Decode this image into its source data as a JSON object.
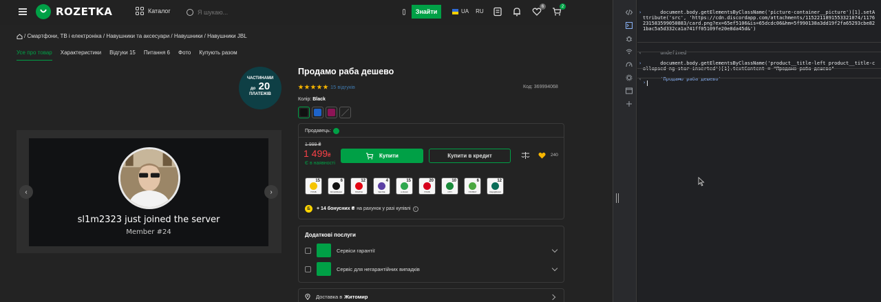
{
  "header": {
    "logo_text": "ROZETKA",
    "catalog_label": "Каталог",
    "search_placeholder": "Я шукаю...",
    "search_button": "Знайти",
    "lang_active": "UA",
    "lang_other": "RU",
    "wishlist_count": "6",
    "cart_count": "2",
    "brand_color": "#00a046"
  },
  "breadcrumb": "/ Смартфони, ТВ і електроніка / Навушники та аксесуари / Навушники / Навушники JBL",
  "tabs": [
    "Усе про товар",
    "Характеристики",
    "Відгуки 15",
    "Питання 6",
    "Фото",
    "Купують разом"
  ],
  "installments": {
    "line1": "ЧАСТИНАМИ",
    "prefix": "до",
    "number": "20",
    "line3": "ПЛАТЕЖІВ"
  },
  "gallery": {
    "join_text": "sl1m2323 just joined the server",
    "member_text": "Member #24"
  },
  "product": {
    "title": "Продамо раба дешево",
    "rating": 5,
    "reviews_link": "15 відгуків",
    "code": "Код: 369994068",
    "color_label": "Колір:",
    "color_value": "Black",
    "seller_label": "Продавець:",
    "old_price": "1 999 ₴",
    "price": "1 499",
    "currency": "₴",
    "in_stock": "Є в наявності",
    "buy_button": "Купити",
    "credit_button": "Купити в кредит",
    "wishlist_count": "240",
    "price_color": "#f84147"
  },
  "banks": [
    {
      "n": "15",
      "name": "ПУМБ",
      "color": "#f5c400"
    },
    {
      "n": "6",
      "name": "МОНОБАНК",
      "color": "#111111"
    },
    {
      "n": "12",
      "name": "ПЛАТІЖ",
      "color": "#e30613"
    },
    {
      "n": "4",
      "name": "SENSE",
      "color": "#5b3fa3"
    },
    {
      "n": "15",
      "name": "А-БАНК",
      "color": "#2fa84f"
    },
    {
      "n": "20",
      "name": "ПУМБ",
      "color": "#d6001c"
    },
    {
      "n": "10",
      "name": "ОТП",
      "color": "#1a8b3b"
    },
    {
      "n": "6",
      "name": "ПРИВАТ",
      "color": "#4aa840"
    },
    {
      "n": "12",
      "name": "ОЩАДБАНК",
      "color": "#0a6d58"
    }
  ],
  "bonus": {
    "icon_letter": "Б",
    "bold": "+ 14 бонусних ₴",
    "text": "на рахунок у разі купівлі"
  },
  "services": {
    "title": "Додаткові послуги",
    "items": [
      "Сервіси гарантії",
      "Сервіс для негарантійних випадків"
    ]
  },
  "delivery": {
    "label": "Доставка в",
    "city": "Житомир"
  },
  "console": {
    "cmd1": "document.body.getElementsByClassName('picture-container__picture')[1].setAttribute('src', 'https://cdn.discordapp.com/attachments/1152211891553321074/1176231583599050883/card.png?ex=65ef5106&is=65dcdc06&hm=5f990138a3dd19f2fa65293cbe821bac5a5d332ca1a741ff05109fe20e8da45d&')",
    "res1": "undefined",
    "cmd2": "document.body.getElementsByClassName('product__title-left product__title-collapsed ng-star-inserted')[1].textContent = \"Продамо раба дешево\"",
    "res2": "'Продамо раба дешево'"
  }
}
